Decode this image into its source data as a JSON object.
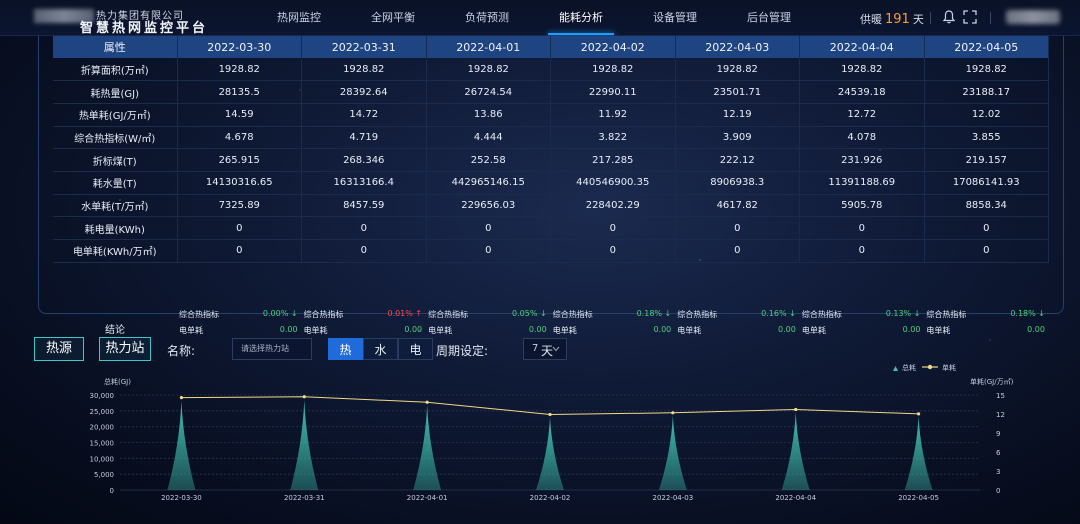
{
  "header": {
    "company": "热力集团有限公司",
    "title": "智慧热网监控平台",
    "nav": [
      "热网监控",
      "全网平衡",
      "负荷预测",
      "能耗分析",
      "设备管理",
      "后台管理"
    ],
    "active_nav": 3,
    "supply_prefix": "供暖",
    "supply_days": "191",
    "supply_suffix": "天",
    "icons": [
      "bell-icon",
      "fullscreen-icon"
    ]
  },
  "table": {
    "attr_header": "属性",
    "dates": [
      "2022-03-30",
      "2022-03-31",
      "2022-04-01",
      "2022-04-02",
      "2022-04-03",
      "2022-04-04",
      "2022-04-05"
    ],
    "rows": [
      {
        "label": "折算面积(万㎡)",
        "values": [
          "1928.82",
          "1928.82",
          "1928.82",
          "1928.82",
          "1928.82",
          "1928.82",
          "1928.82"
        ]
      },
      {
        "label": "耗热量(GJ)",
        "values": [
          "28135.5",
          "28392.64",
          "26724.54",
          "22990.11",
          "23501.71",
          "24539.18",
          "23188.17"
        ]
      },
      {
        "label": "热单耗(GJ/万㎡)",
        "values": [
          "14.59",
          "14.72",
          "13.86",
          "11.92",
          "12.19",
          "12.72",
          "12.02"
        ]
      },
      {
        "label": "综合热指标(W/㎡)",
        "values": [
          "4.678",
          "4.719",
          "4.444",
          "3.822",
          "3.909",
          "4.078",
          "3.855"
        ]
      },
      {
        "label": "折标煤(T)",
        "values": [
          "265.915",
          "268.346",
          "252.58",
          "217.285",
          "222.12",
          "231.926",
          "219.157"
        ]
      },
      {
        "label": "耗水量(T)",
        "values": [
          "14130316.65",
          "16313166.4",
          "442965146.15",
          "440546900.35",
          "8906938.3",
          "11391188.69",
          "17086141.93"
        ]
      },
      {
        "label": "水单耗(T/万㎡)",
        "values": [
          "7325.89",
          "8457.59",
          "229656.03",
          "228402.29",
          "4617.82",
          "5905.78",
          "8858.34"
        ]
      },
      {
        "label": "耗电量(KWh)",
        "values": [
          "0",
          "0",
          "0",
          "0",
          "0",
          "0",
          "0"
        ]
      },
      {
        "label": "电单耗(KWh/万㎡)",
        "values": [
          "0",
          "0",
          "0",
          "0",
          "0",
          "0",
          "0"
        ]
      }
    ],
    "conclusion_label": "结论",
    "conclusion": [
      {
        "l1": "综合热指标",
        "v1": "0.00% ↓",
        "d1": "down",
        "l2": "电单耗",
        "v2": "0.00"
      },
      {
        "l1": "综合热指标",
        "v1": "0.01% ↑",
        "d1": "up",
        "l2": "电单耗",
        "v2": "0.00"
      },
      {
        "l1": "综合热指标",
        "v1": "0.05% ↓",
        "d1": "down",
        "l2": "电单耗",
        "v2": "0.00"
      },
      {
        "l1": "综合热指标",
        "v1": "0.18% ↓",
        "d1": "down",
        "l2": "电单耗",
        "v2": "0.00"
      },
      {
        "l1": "综合热指标",
        "v1": "0.16% ↓",
        "d1": "down",
        "l2": "电单耗",
        "v2": "0.00"
      },
      {
        "l1": "综合热指标",
        "v1": "0.13% ↓",
        "d1": "down",
        "l2": "电单耗",
        "v2": "0.00"
      },
      {
        "l1": "综合热指标",
        "v1": "0.18% ↓",
        "d1": "down",
        "l2": "电单耗",
        "v2": "0.00"
      }
    ]
  },
  "filter": {
    "source_btn": "热源",
    "station_btn": "热力站",
    "name_label": "名称:",
    "name_placeholder": "请选择热力站",
    "types": [
      "热",
      "水",
      "电"
    ],
    "active_type": 0,
    "period_label": "周期设定:",
    "period_value": "7",
    "period_unit": "天"
  },
  "colors": {
    "header_row": "#1f4482",
    "accent": "#1e9bff",
    "up": "#ff4646",
    "down": "#4fd07a",
    "bar_fill": "#3fbfae",
    "line": "#f2d985"
  },
  "chart_data": {
    "type": "bar",
    "categories": [
      "2022-03-30",
      "2022-03-31",
      "2022-04-01",
      "2022-04-02",
      "2022-04-03",
      "2022-04-04",
      "2022-04-05"
    ],
    "series": [
      {
        "name": "总耗",
        "type": "bar",
        "axis": "left",
        "values": [
          28135.5,
          28392.64,
          26724.54,
          22990.11,
          23501.71,
          24539.18,
          23188.17
        ]
      },
      {
        "name": "单耗",
        "type": "line",
        "axis": "right",
        "values": [
          14.59,
          14.72,
          13.86,
          11.92,
          12.19,
          12.72,
          12.02
        ]
      }
    ],
    "ylabel_left": "总耗(GJ)",
    "ylabel_right": "单耗(GJ/万㎡)",
    "ylim_left": [
      0,
      30000
    ],
    "yticks_left": [
      "0",
      "5,000",
      "10,000",
      "15,000",
      "20,000",
      "25,000",
      "30,000"
    ],
    "ylim_right": [
      0,
      15
    ],
    "yticks_right": [
      "0",
      "3",
      "6",
      "9",
      "12",
      "15"
    ],
    "legend_position": "top-right",
    "grid": true
  }
}
